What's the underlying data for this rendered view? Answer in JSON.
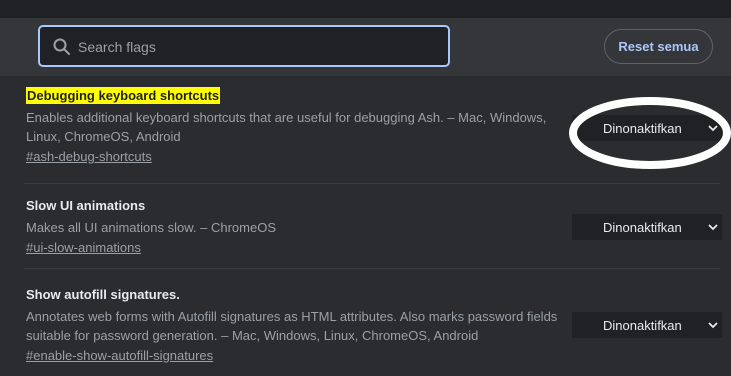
{
  "header": {
    "search": {
      "placeholder": "Search flags",
      "value": ""
    },
    "reset_button": "Reset semua"
  },
  "flags": [
    {
      "title": "Debugging keyboard shortcuts",
      "highlighted": true,
      "desc_line1": "Enables additional keyboard shortcuts that are useful for debugging Ash. – Mac, Windows,",
      "desc_line2": "Linux, ChromeOS, Android",
      "link": "#ash-debug-shortcuts",
      "selected": "Dinonaktifkan"
    },
    {
      "title": "Slow UI animations",
      "highlighted": false,
      "desc_line1": "Makes all UI animations slow. – ChromeOS",
      "link": "#ui-slow-animations",
      "selected": "Dinonaktifkan"
    },
    {
      "title": "Show autofill signatures.",
      "highlighted": false,
      "desc_line1": "Annotates web forms with Autofill signatures as HTML attributes. Also marks password fields",
      "desc_line2": "suitable for password generation. – Mac, Windows, Linux, ChromeOS, Android",
      "link": "#enable-show-autofill-signatures",
      "selected": "Dinonaktifkan"
    }
  ],
  "colors": {
    "highlight": "#ffff00",
    "accent": "#a8c7fa",
    "annotation_circle": "#ffffff"
  }
}
